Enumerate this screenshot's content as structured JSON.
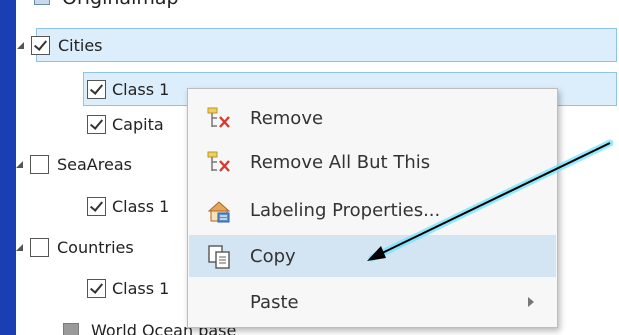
{
  "toc": {
    "map_name": "Originalmap",
    "layers": [
      {
        "label": "Cities",
        "checked": true
      },
      {
        "label": "Class 1",
        "checked": true
      },
      {
        "label": "Capita",
        "checked": true
      },
      {
        "label": "SeaAreas",
        "checked": false
      },
      {
        "label": "Class 1",
        "checked": true
      },
      {
        "label": "Countries",
        "checked": false
      },
      {
        "label": "Class 1",
        "checked": true
      },
      {
        "label": "World Ocean base"
      }
    ]
  },
  "context_menu": {
    "items": [
      {
        "label": "Remove",
        "icon": "remove-layer-icon"
      },
      {
        "label": "Remove All But This",
        "icon": "remove-all-layers-icon"
      },
      {
        "label": "Labeling Properties...",
        "icon": "labeling-properties-icon"
      },
      {
        "label": "Copy",
        "icon": "copy-icon",
        "highlighted": true
      },
      {
        "label": "Paste",
        "submenu": true
      }
    ]
  },
  "colors": {
    "frame": "#1a3fb4",
    "selection": "#dceefb",
    "menu_highlight": "#d3e4f3",
    "annotation_glow": "#6fe3ff"
  }
}
